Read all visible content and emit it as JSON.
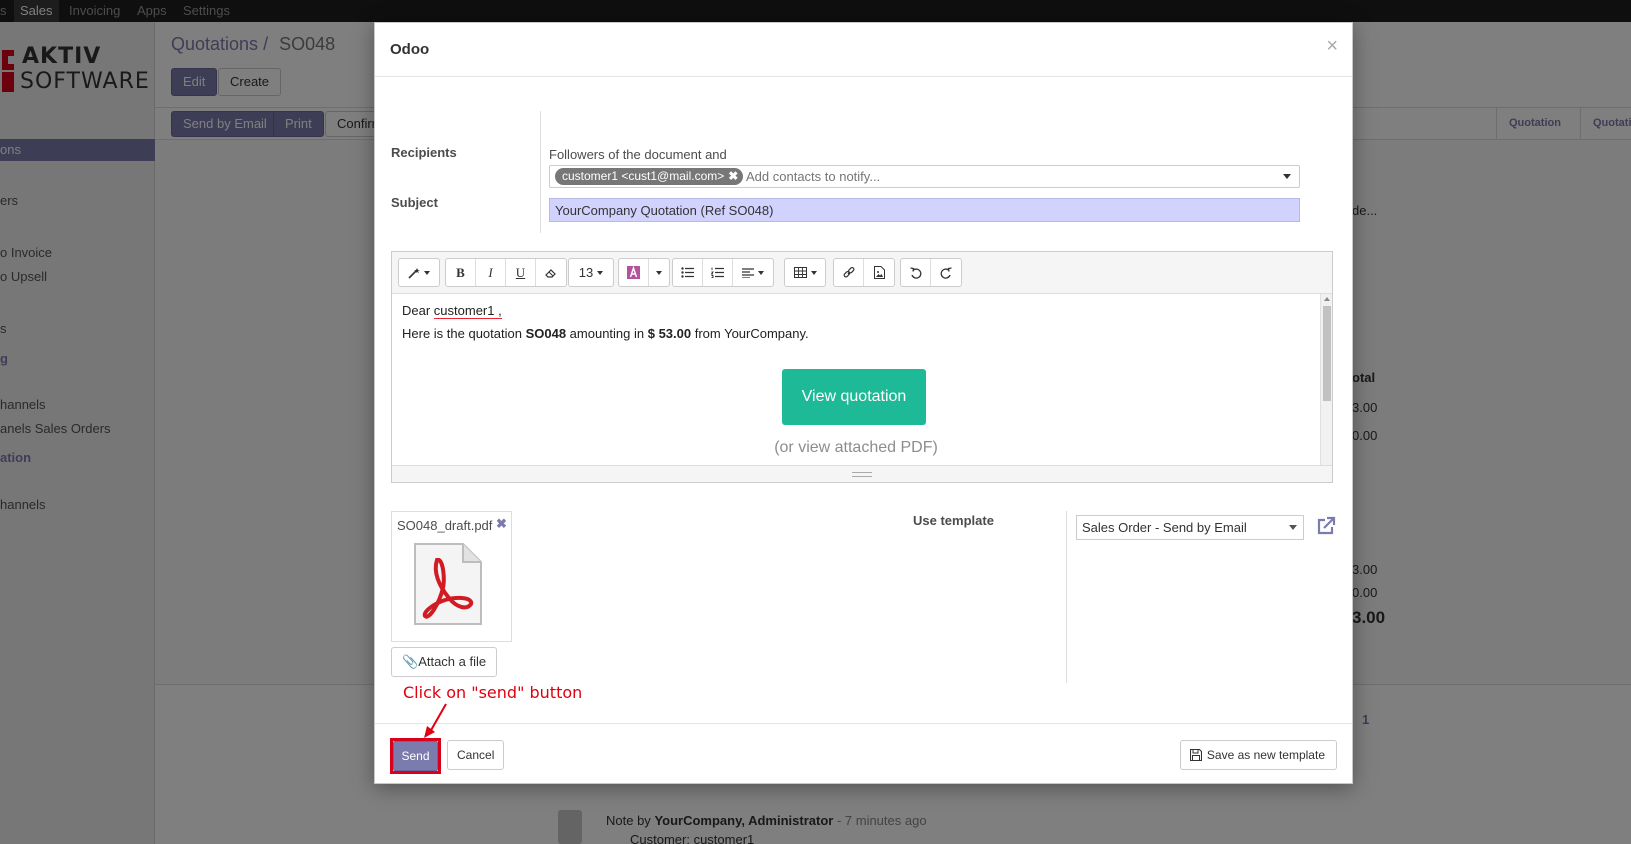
{
  "topbar": {
    "menu": [
      "s",
      "Sales",
      "Invoicing",
      "Apps",
      "Settings"
    ],
    "active": "Sales"
  },
  "sidebar": {
    "logo_line1": "AKTIV",
    "logo_line2": "SOFTWARE",
    "items": [
      "ons",
      "ers",
      "o Invoice",
      "o Upsell",
      "s",
      "g",
      "hannels",
      "anels Sales Orders",
      "ation",
      "hannels"
    ]
  },
  "breadcrumb": {
    "parent": "Quotations",
    "separator": "/",
    "current": "SO048"
  },
  "form_buttons": {
    "edit": "Edit",
    "create": "Create"
  },
  "status_buttons": {
    "send_by_email": "Send by Email",
    "print": "Print",
    "confirm": "Confirm"
  },
  "stages": [
    "Quotation",
    "Quotatio"
  ],
  "background_values": [
    "de...",
    "otal",
    "3.00",
    "0.00",
    "3.00",
    "0.00",
    "3.00"
  ],
  "chatter": {
    "followers_count": "1",
    "note_prefix": "Note by",
    "author": "YourCompany, Administrator",
    "time": "- 7 minutes ago",
    "bullet": "Customer: customer1"
  },
  "modal": {
    "title": "Odoo",
    "close": "×",
    "recipients_label": "Recipients",
    "followers_text": "Followers of the document and",
    "recipient_tag": "customer1 <cust1@mail.com>",
    "add_contacts_placeholder": "Add contacts to notify...",
    "subject_label": "Subject",
    "subject_value": "YourCompany Quotation (Ref SO048)",
    "toolbar": {
      "font_size": "13"
    },
    "body": {
      "greeting_prefix": "Dear ",
      "greeting_name": "customer1 ,",
      "line2_a": "Here is the quotation ",
      "line2_ref": "SO048",
      "line2_b": " amounting in ",
      "line2_amount": "$ 53.00",
      "line2_c": " from YourCompany.",
      "view_button": "View quotation",
      "pdf_note": "(or view attached PDF)"
    },
    "attachment": {
      "filename": "SO048_draft.pdf",
      "remove": "✖"
    },
    "attach_button": "Attach a file",
    "template_label": "Use template",
    "template_value": "Sales Order - Send by Email",
    "send": "Send",
    "cancel": "Cancel",
    "save_template": "Save as new template"
  },
  "annotation": {
    "text": "Click on \"send\" button",
    "color": "#e0000f"
  },
  "colors": {
    "primary": "#7c7bad",
    "accent_green": "#1eb996",
    "highlight_red": "#d9001b"
  }
}
